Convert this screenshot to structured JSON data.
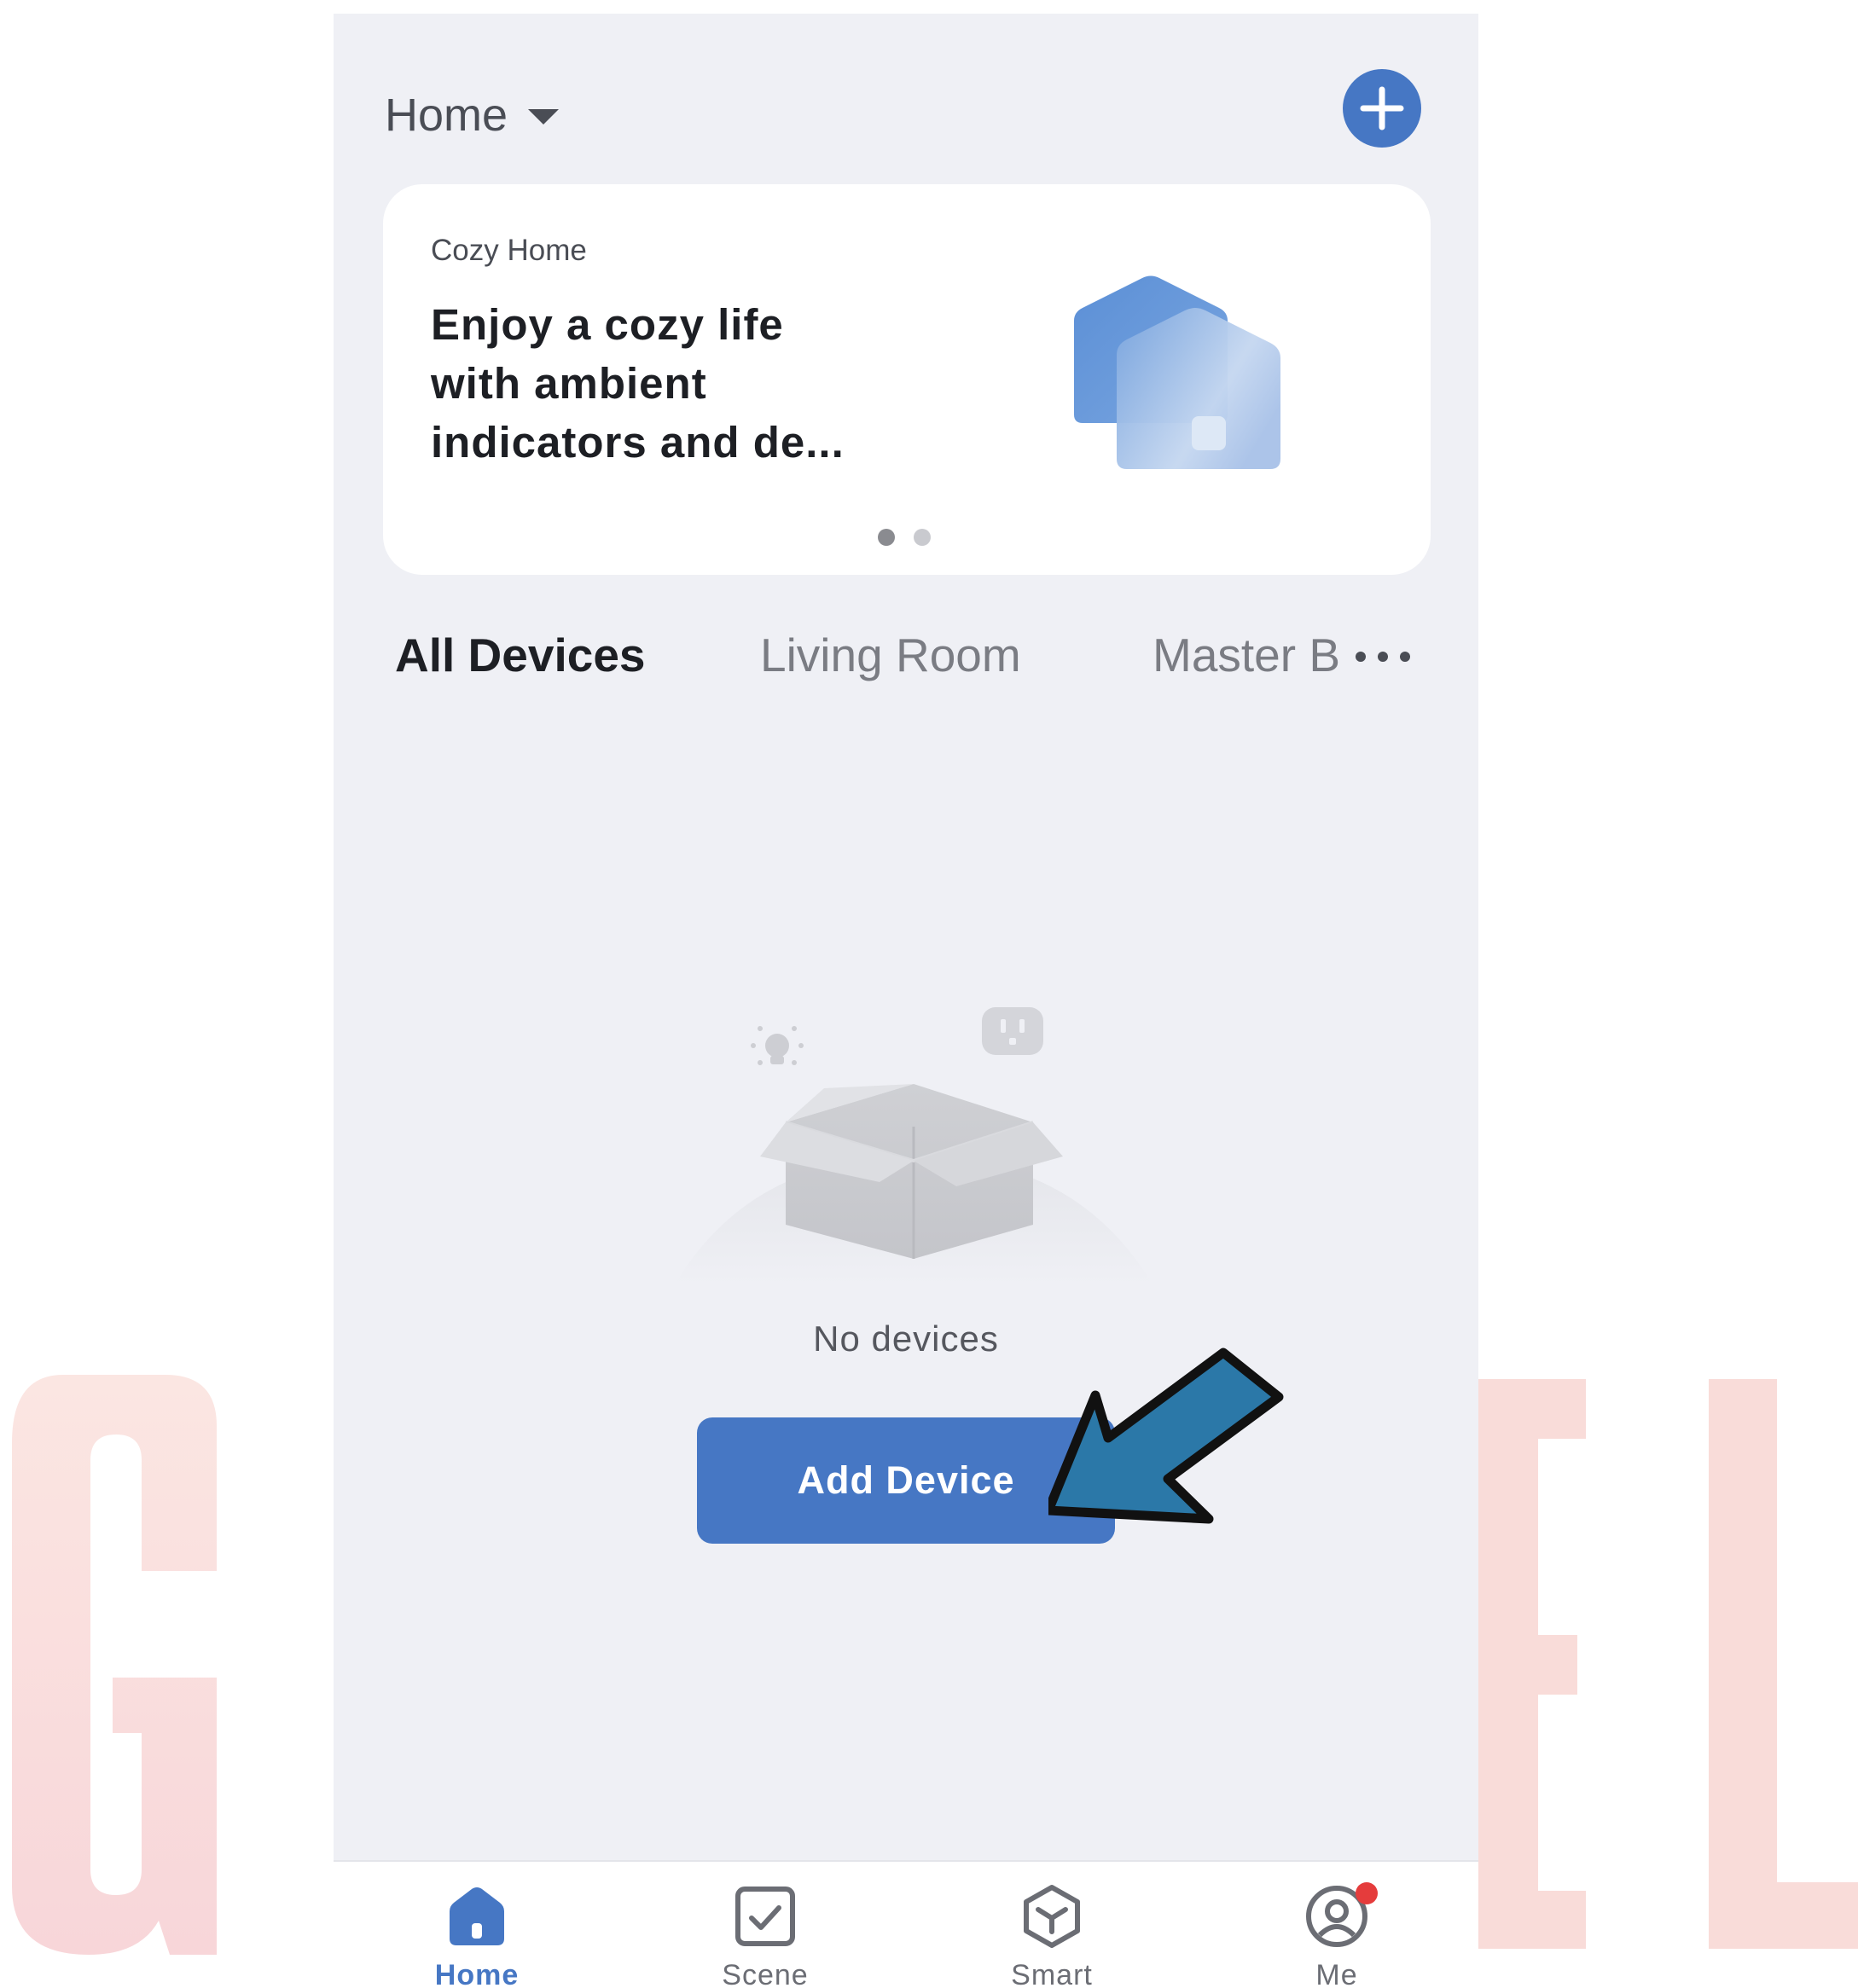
{
  "header": {
    "home_label": "Home"
  },
  "banner": {
    "tag": "Cozy Home",
    "lines": [
      "Enjoy a cozy life",
      "with ambient",
      "indicators and de..."
    ],
    "page_count": 2,
    "active_page": 1
  },
  "tabs": [
    {
      "label": "All Devices",
      "active": true
    },
    {
      "label": "Living Room",
      "active": false
    },
    {
      "label": "Master Bedroom",
      "active": false
    }
  ],
  "empty_state": {
    "message": "No devices",
    "button_label": "Add Device"
  },
  "bottom_nav": [
    {
      "label": "Home",
      "icon": "home-icon",
      "active": true
    },
    {
      "label": "Scene",
      "icon": "scene-icon",
      "active": false
    },
    {
      "label": "Smart",
      "icon": "smart-icon",
      "active": false
    },
    {
      "label": "Me",
      "icon": "profile-icon",
      "active": false,
      "badge": true
    }
  ],
  "colors": {
    "accent": "#4677c4",
    "background": "#eff0f5",
    "badge": "#e53c3c",
    "watermark": "#f7d9d9",
    "annotation_arrow": "#2b78a8"
  }
}
